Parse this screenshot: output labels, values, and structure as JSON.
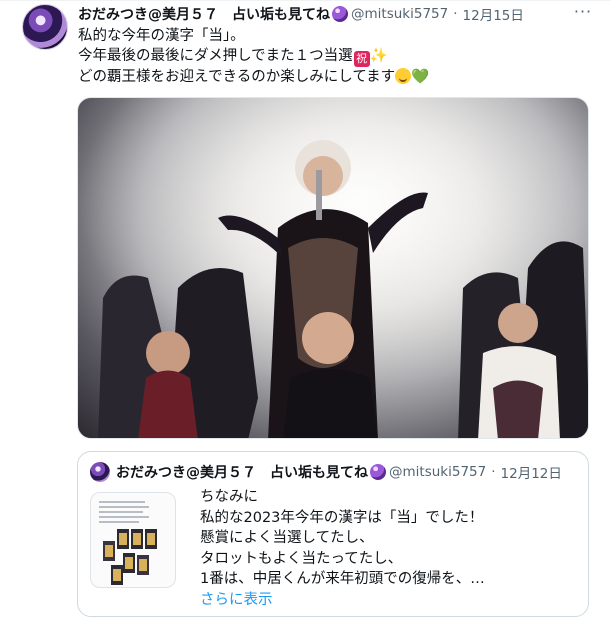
{
  "tweet": {
    "display_name": "おだみつき@美月５７　占い垢も見てね",
    "handle": "@mitsuki5757",
    "separator": "·",
    "date": "12月15日",
    "more_label": "···",
    "lines": [
      "私的な今年の漢字「当」。",
      "今年最後の最後にダメ押しでまた１つ当選",
      "どの覇王様をお迎えできるのか楽しみにしてます"
    ],
    "emoji": {
      "iwai": "祝",
      "sparkles": "✨",
      "heart": "💚"
    },
    "image": {
      "icon": "concert-photo"
    }
  },
  "quote": {
    "display_name": "おだみつき@美月５７　占い垢も見てね",
    "handle": "@mitsuki5757",
    "separator": "·",
    "date": "12月12日",
    "lines": [
      "ちなみに",
      "私的な2023年今年の漢字は「当」でした！",
      "懸賞によく当選してたし、",
      "タロットもよく当たってたし、",
      "1番は、中居くんが来年初頭での復帰を、…"
    ],
    "show_more": "さらに表示",
    "thumbnail": {
      "icon": "tarot-cards-thumbnail"
    }
  },
  "colors": {
    "text": "#0f1419",
    "secondary": "#536471",
    "link": "#1d9bf0",
    "border": "#cfd9de"
  }
}
